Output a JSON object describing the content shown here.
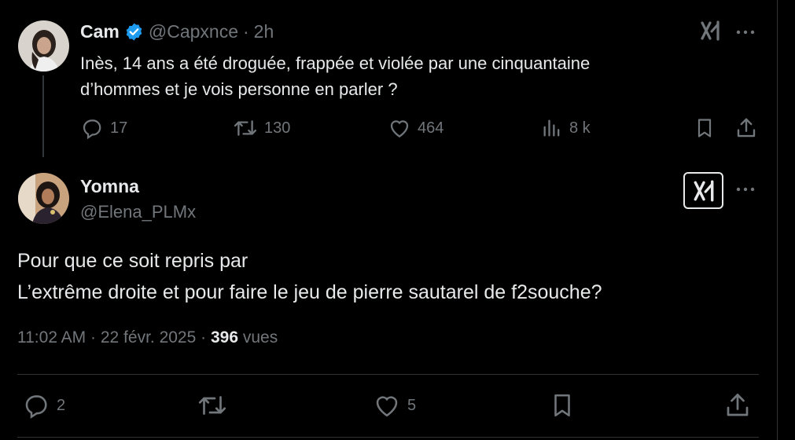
{
  "parent_tweet": {
    "display_name": "Cam",
    "handle": "@Capxnce",
    "separator": "·",
    "time": "2h",
    "text_line1": "Inès, 14 ans a été droguée, frappée et violée par une cinquantaine",
    "text_line2": "d’hommes et je vois personne en parler ?",
    "replies": "17",
    "reposts": "130",
    "likes": "464",
    "views": "8 k"
  },
  "reply_tweet": {
    "display_name": "Yomna",
    "handle": "@Elena_PLMx",
    "text_line1": "Pour que ce soit repris par",
    "text_line2": "L’extrême droite et pour faire le jeu de pierre sautarel de f2souche?",
    "time": "11:02 AM",
    "sep1": "·",
    "date": "22 févr. 2025",
    "sep2": "·",
    "views_count": "396",
    "views_label": "vues",
    "replies": "2",
    "likes": "5"
  },
  "icons": {
    "verified": "verified-badge-icon",
    "grok": "grok-icon",
    "more": "more-icon",
    "reply": "reply-icon",
    "repost": "repost-icon",
    "like": "like-icon",
    "views": "views-icon",
    "bookmark": "bookmark-icon",
    "share": "share-icon"
  },
  "colors": {
    "background": "#000000",
    "text": "#e7e9ea",
    "muted": "#71767b",
    "verified": "#1d9bf0",
    "border": "#2f3336"
  }
}
